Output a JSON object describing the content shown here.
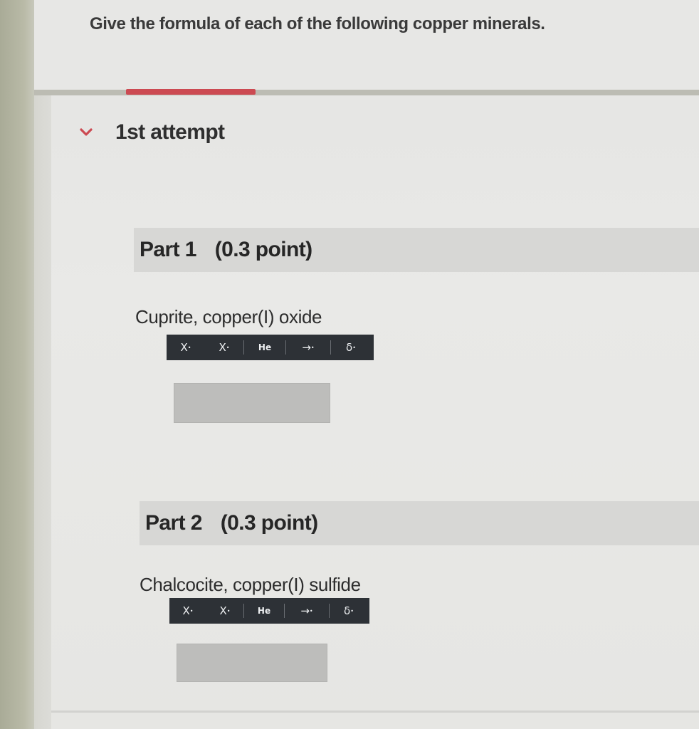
{
  "question": {
    "text": "Give the formula of each of the following copper minerals."
  },
  "attempt": {
    "label": "1st attempt"
  },
  "parts": [
    {
      "title": "Part 1",
      "points": "(0.3 point)",
      "prompt": "Cuprite, copper(I) oxide",
      "toolbar": {
        "sup": "X",
        "sub": "X",
        "element": "He",
        "arrow": "→",
        "delta": "δ"
      }
    },
    {
      "title": "Part 2",
      "points": "(0.3 point)",
      "prompt": "Chalcocite, copper(I) sulfide",
      "toolbar": {
        "sup": "X",
        "sub": "X",
        "element": "He",
        "arrow": "→",
        "delta": "δ"
      }
    }
  ],
  "colors": {
    "progress": "#cc4a52",
    "toolbar": "#2d3136",
    "answer_box": "#bdbdbb"
  },
  "icons": {
    "chevron": "chevron-down-icon",
    "arrow": "reaction-arrow-icon",
    "delta": "delta-icon"
  }
}
